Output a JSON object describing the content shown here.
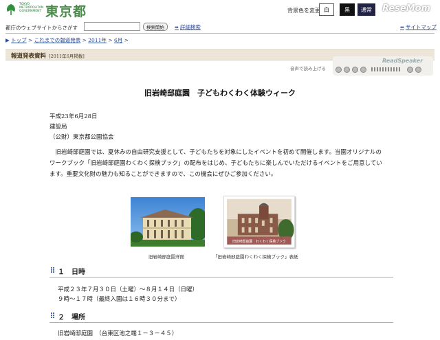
{
  "header": {
    "logo_small_line1": "TOKYO",
    "logo_small_line2": "METROPOLITAN",
    "logo_small_line3": "GOVERNMENT",
    "logo_text": "東京都",
    "bg_color_label": "背景色を変更",
    "bg_white": "白",
    "bg_black": "黒",
    "bg_normal": "通常",
    "watermark": "ReseMom"
  },
  "search": {
    "label": "都庁のウェブサイトからさがす",
    "value": "",
    "button": "検索開始",
    "advanced": "詳細検索",
    "sitemap": "サイトマップ"
  },
  "breadcrumb": [
    "トップ",
    "これまでの報道発表",
    "2011年",
    "6月"
  ],
  "press": {
    "title": "報道発表資料",
    "date": "[2011年6月掲載]"
  },
  "readspeaker": {
    "label": "音声で読み上げる",
    "brand": "ReadSpeaker"
  },
  "article": {
    "title": "旧岩崎邸庭園　子どもわくわく体験ウィーク",
    "date": "平成23年6月28日",
    "dept": "建設局",
    "org": "（公財）東京都公園協会",
    "paragraph": "旧岩崎邸庭園では、夏休みの自由研究支援として、子どもたちを対象にしたイベントを初めて開催します。当園オリジナルのワークブック「旧岩崎邸庭園わくわく探検ブック」の配布をはじめ、子どもたちに楽しんでいただけるイベントをご用意しています。重要文化財の魅力も知ることができますので、この機会にぜひご参加ください。",
    "caption1": "旧岩崎邸庭園洋館",
    "caption2": "「旧岩崎邸庭園わくわく探検ブック」表紙",
    "book_label": "旧岩崎邸庭園　わくわく探検ブック"
  },
  "sections": [
    {
      "heading": "１　日時",
      "lines": [
        "平成２３年７月３０日（土曜）～８月１４日（日曜）",
        "９時～１７時（最終入園は１６時３０分まで）"
      ]
    },
    {
      "heading": "２　場所",
      "lines": [
        "旧岩崎邸庭園　（台東区池之端１－３－４５）"
      ]
    }
  ],
  "colors": {
    "link": "#2c4a9a",
    "band": "#ede6d8",
    "logo_green": "#4a8a4a"
  }
}
